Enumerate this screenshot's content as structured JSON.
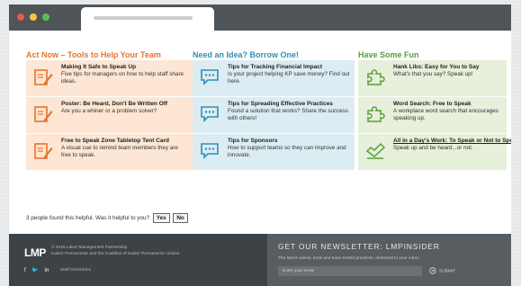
{
  "columns": [
    {
      "title": "Act Now – Tools to Help Your Team",
      "color": "#e8722c",
      "items": [
        {
          "icon": "pencil-paper-icon",
          "title": "Making It Safe to Speak Up",
          "desc": "Five tips for managers on how to help staff share ideas."
        },
        {
          "icon": "pencil-paper-icon",
          "title": "Poster: Be Heard, Don't Be Written Off",
          "desc": "Are you a whiner or a problem solver?"
        },
        {
          "icon": "pencil-paper-icon",
          "title": "Free to Speak Zone Tabletop Tent Card",
          "desc": "A visual cue to remind team members they are free to speak."
        }
      ]
    },
    {
      "title": "Need an Idea? Borrow One!",
      "color": "#2e8fb6",
      "items": [
        {
          "icon": "speech-bubble-icon",
          "title": "Tips for Tracking Financial Impact",
          "desc": "Is your project helping KP save money? Find out here."
        },
        {
          "icon": "speech-bubble-icon",
          "title": "Tips for Spreading Effective Practices",
          "desc": "Found a solution that works? Share the success with others!"
        },
        {
          "icon": "speech-bubble-icon",
          "title": "Tips for Sponsors",
          "desc": "How to support teams so they can improve and innovate."
        }
      ]
    },
    {
      "title": "Have Some Fun",
      "color": "#5a9d3a",
      "items": [
        {
          "icon": "puzzle-icon",
          "title": "Hank Libs: Easy for You to Say",
          "desc": "What's that you say? Speak up!"
        },
        {
          "icon": "puzzle-icon",
          "title": "Word Search: Free to Speak",
          "desc": "A workplace word search that encourages speaking up."
        },
        {
          "icon": "thumbs-up-check-icon",
          "title": "All in a Day's Work: To Speak or Not to Speak",
          "desc": "Speak up and be heard...or not."
        }
      ]
    }
  ],
  "feedback": {
    "question": "3 people found this helpful. Was it helpful to you?",
    "yes": "Yes",
    "no": "No"
  },
  "footer": {
    "logo": "LMP",
    "copyright_line1": "© 2016 Labor Management Partnership",
    "copyright_line2": "Kaiser Permanente and the Coalition of Kaiser Permanente Unions",
    "social_icons": [
      "facebook-icon",
      "twitter-icon",
      "linkedin-icon"
    ],
    "social_glyphs": [
      "f",
      "🐦",
      "in"
    ],
    "staff_directory": "Staff Directories",
    "newsletter_title": "GET OUR NEWSLETTER: LMPINSIDER",
    "newsletter_sub": "The latest videos, tools and team-tested practices, delivered to your inbox.",
    "email_placeholder": "Enter your email",
    "submit": "SUBMIT"
  }
}
